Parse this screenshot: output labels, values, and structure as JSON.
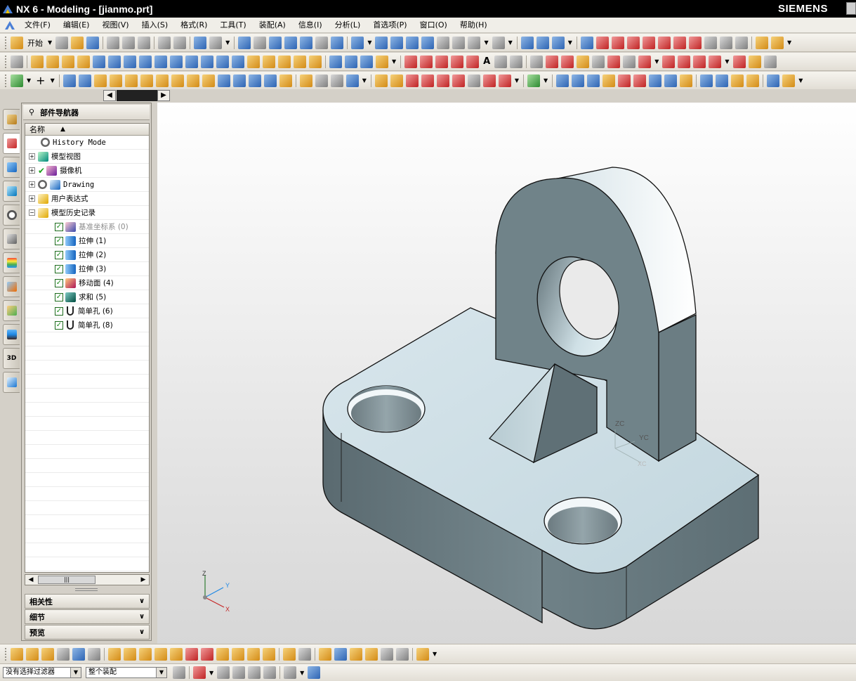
{
  "window": {
    "title": "NX 6 - Modeling - [jianmo.prt]",
    "brand": "SIEMENS"
  },
  "menu": [
    {
      "label": "文件(F)"
    },
    {
      "label": "编辑(E)"
    },
    {
      "label": "视图(V)"
    },
    {
      "label": "插入(S)"
    },
    {
      "label": "格式(R)"
    },
    {
      "label": "工具(T)"
    },
    {
      "label": "装配(A)"
    },
    {
      "label": "信息(I)"
    },
    {
      "label": "分析(L)"
    },
    {
      "label": "首选项(P)"
    },
    {
      "label": "窗口(O)"
    },
    {
      "label": "帮助(H)"
    }
  ],
  "toolbar": {
    "start_label": "开始"
  },
  "navigator": {
    "title": "部件导航器",
    "column_name": "名称",
    "sort_indicator": "▲",
    "tree": [
      {
        "label": "History Mode",
        "type": "mode"
      },
      {
        "label": "模型视图",
        "type": "group"
      },
      {
        "label": "摄像机",
        "type": "group"
      },
      {
        "label": "Drawing",
        "type": "group"
      },
      {
        "label": "用户表达式",
        "type": "group"
      },
      {
        "label": "模型历史记录",
        "type": "group-open"
      }
    ],
    "features": [
      {
        "label": "基准坐标系 (0)",
        "dim": true
      },
      {
        "label": "拉伸 (1)"
      },
      {
        "label": "拉伸 (2)"
      },
      {
        "label": "拉伸 (3)"
      },
      {
        "label": "移动面 (4)"
      },
      {
        "label": "求和 (5)"
      },
      {
        "label": "简单孔 (6)"
      },
      {
        "label": "简单孔 (8)"
      }
    ],
    "panels": [
      {
        "label": "相关性"
      },
      {
        "label": "细节"
      },
      {
        "label": "预览"
      }
    ]
  },
  "viewport": {
    "wcs": {
      "z": "ZC",
      "y": "YC",
      "x": "XC"
    },
    "triad": {
      "z": "Z",
      "y": "Y",
      "x": "X"
    }
  },
  "statusbar": {
    "filter": "没有选择过滤器",
    "scope": "整个装配"
  }
}
